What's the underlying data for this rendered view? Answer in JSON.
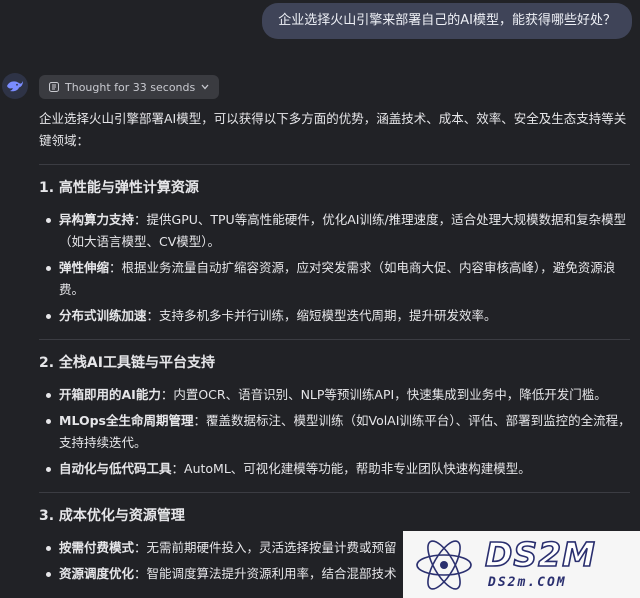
{
  "user_message": "企业选择火山引擎来部署自己的AI模型，能获得哪些好处？",
  "thought": {
    "label": "Thought for 33 seconds"
  },
  "answer": {
    "intro": "企业选择火山引擎部署AI模型，可以获得以下多方面的优势，涵盖技术、成本、效率、安全及生态支持等关键领域：",
    "sections": [
      {
        "title": "1. 高性能与弹性计算资源",
        "items": [
          {
            "term": "异构算力支持",
            "text": "：提供GPU、TPU等高性能硬件，优化AI训练/推理速度，适合处理大规模数据和复杂模型（如大语言模型、CV模型）。"
          },
          {
            "term": "弹性伸缩",
            "text": "：根据业务流量自动扩缩容资源，应对突发需求（如电商大促、内容审核高峰），避免资源浪费。"
          },
          {
            "term": "分布式训练加速",
            "text": "：支持多机多卡并行训练，缩短模型迭代周期，提升研发效率。"
          }
        ]
      },
      {
        "title": "2. 全栈AI工具链与平台支持",
        "items": [
          {
            "term": "开箱即用的AI能力",
            "text": "：内置OCR、语音识别、NLP等预训练API，快速集成到业务中，降低开发门槛。"
          },
          {
            "term": "MLOps全生命周期管理",
            "text": "：覆盖数据标注、模型训练（如VolAI训练平台）、评估、部署到监控的全流程，支持持续迭代。"
          },
          {
            "term": "自动化与低代码工具",
            "text": "：AutoML、可视化建模等功能，帮助非专业团队快速构建模型。"
          }
        ]
      },
      {
        "title": "3. 成本优化与资源管理",
        "items": [
          {
            "term": "按需付费模式",
            "text": "：无需前期硬件投入，灵活选择按量计费或预留"
          },
          {
            "term": "资源调度优化",
            "text": "：智能调度算法提升资源利用率，结合混部技术"
          }
        ]
      }
    ]
  },
  "watermark": {
    "main": "DS2M",
    "sub": "DS2m.COM"
  },
  "colors": {
    "background": "#212226",
    "bubble": "#3f4458",
    "text": "#e6e6e9",
    "watermark": "#2a2f6f"
  },
  "icons": {
    "avatar": "whale-logo-icon",
    "thought": "brain-icon",
    "chevron": "chevron-down-icon",
    "watermark": "atom-icon"
  }
}
